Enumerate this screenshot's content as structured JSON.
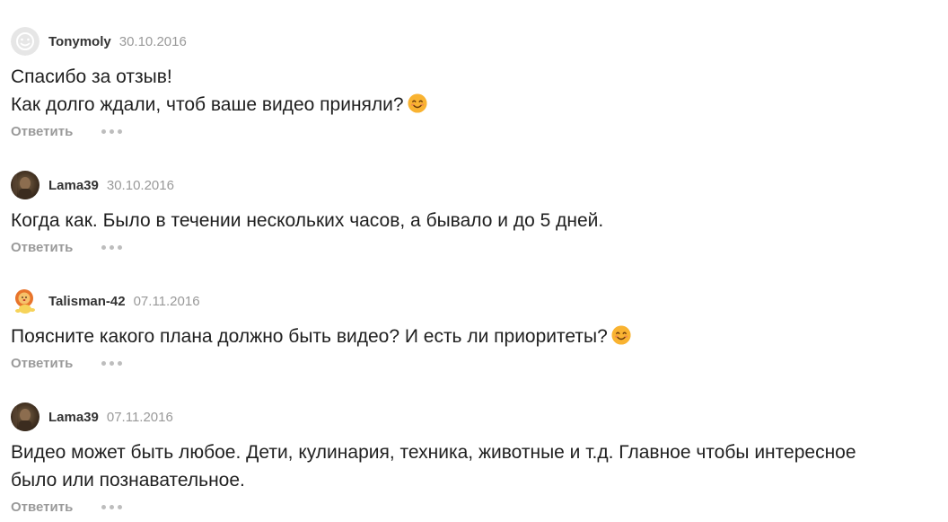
{
  "comments": [
    {
      "author": "Tonymoly",
      "date": "30.10.2016",
      "avatar": "smiley-placeholder-icon",
      "lines": [
        "Спасибо за отзыв!",
        "Как долго ждали, чтоб ваше видео приняли?"
      ],
      "emoji_after_last_line": "smiling-face-emoji",
      "reply_label": "Ответить"
    },
    {
      "author": "Lama39",
      "date": "30.10.2016",
      "avatar": "photo-avatar",
      "lines": [
        "Когда как. Было в течении нескольких часов, а бывало и до 5 дней."
      ],
      "reply_label": "Ответить"
    },
    {
      "author": "Talisman-42",
      "date": "07.11.2016",
      "avatar": "lion-cub-avatar",
      "lines": [
        "Поясните какого плана должно быть видео? И есть ли приоритеты?"
      ],
      "emoji_after_last_line": "smiling-face-emoji",
      "reply_label": "Ответить"
    },
    {
      "author": "Lama39",
      "date": "07.11.2016",
      "avatar": "photo-avatar",
      "lines": [
        "Видео может быть любое. Дети, кулинария, техника, животные и т.д. Главное чтобы интересное",
        "было или познавательное."
      ],
      "reply_label": "Ответить"
    }
  ],
  "colors": {
    "author": "#333333",
    "date": "#999999",
    "reply": "#9a9a9a",
    "dots": "#bdbdbd",
    "emoji": "#f5a623"
  }
}
